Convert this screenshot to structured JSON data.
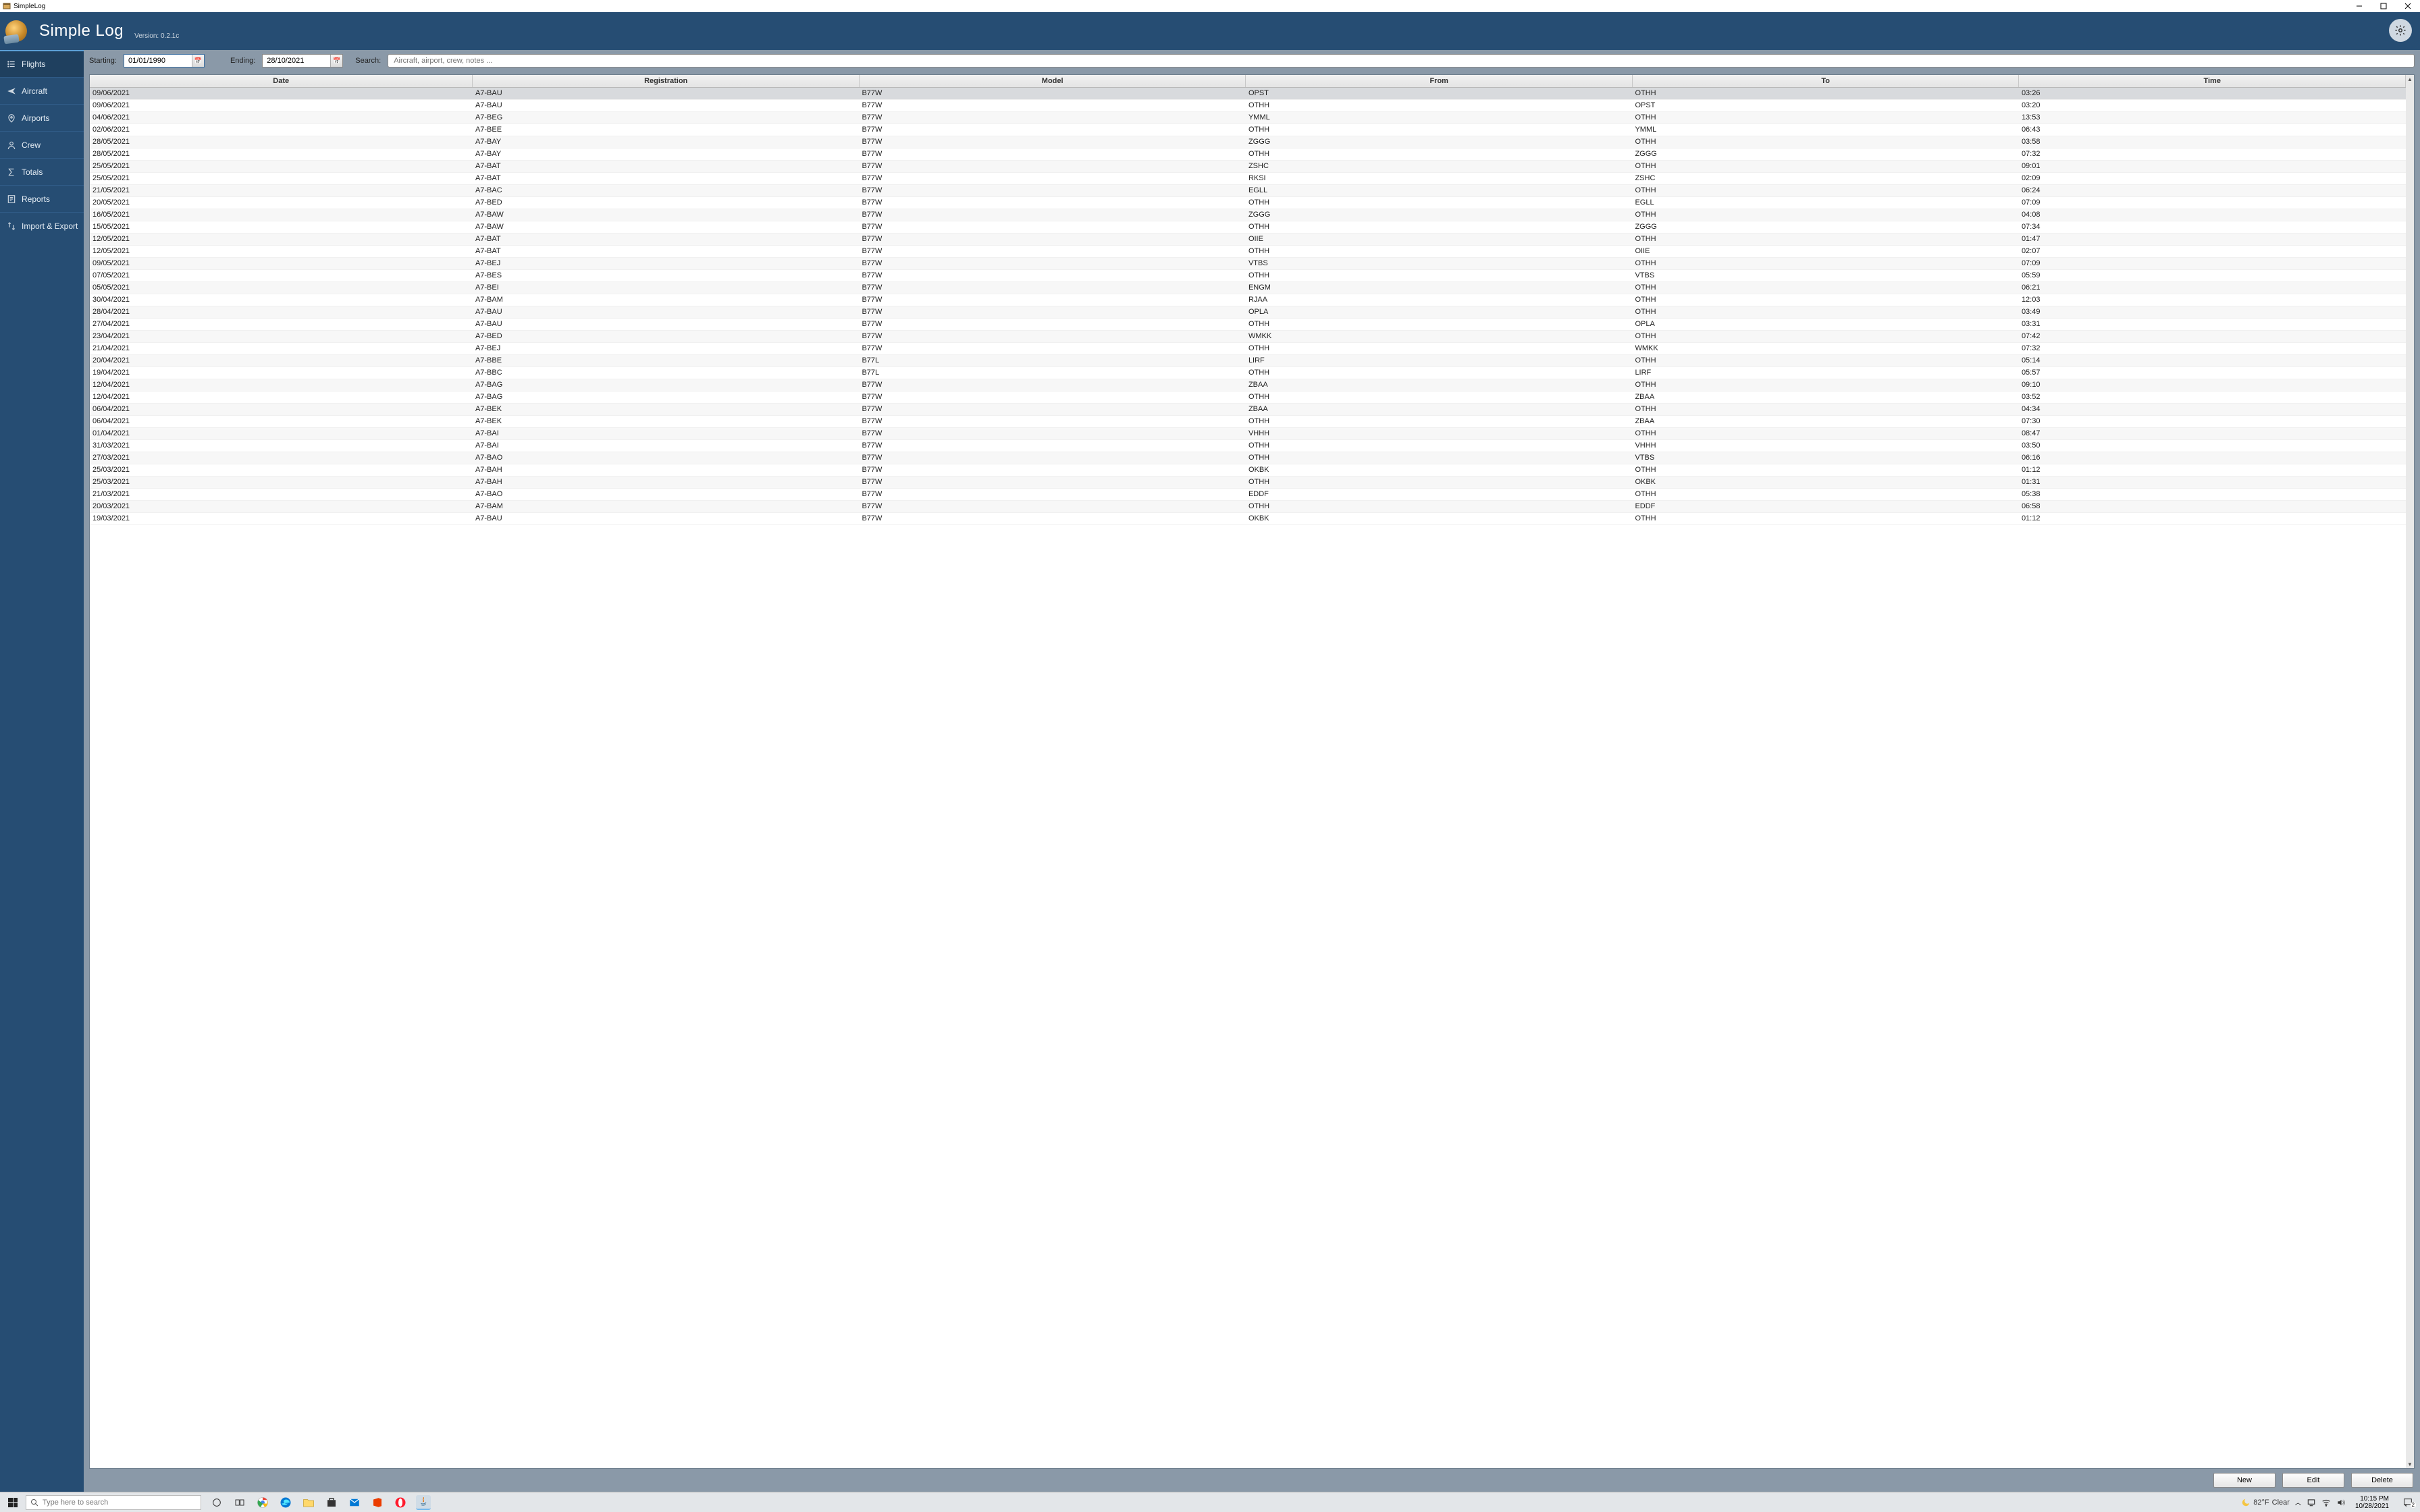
{
  "window": {
    "title": "SimpleLog"
  },
  "header": {
    "title": "Simple Log",
    "version": "Version: 0.2.1c"
  },
  "sidebar": {
    "items": [
      {
        "label": "Flights",
        "icon": "list-icon",
        "active": true
      },
      {
        "label": "Aircraft",
        "icon": "plane-icon",
        "active": false
      },
      {
        "label": "Airports",
        "icon": "pin-icon",
        "active": false
      },
      {
        "label": "Crew",
        "icon": "person-icon",
        "active": false
      },
      {
        "label": "Totals",
        "icon": "sigma-icon",
        "active": false
      },
      {
        "label": "Reports",
        "icon": "report-icon",
        "active": false
      },
      {
        "label": "Import & Export",
        "icon": "transfer-icon",
        "active": false
      }
    ]
  },
  "filters": {
    "starting_label": "Starting:",
    "ending_label": "Ending:",
    "search_label": "Search:",
    "starting_value": "01/01/1990",
    "ending_value": "28/10/2021",
    "search_placeholder": "Aircraft, airport, crew, notes ..."
  },
  "columns": [
    "Date",
    "Registration",
    "Model",
    "From",
    "To",
    "Time"
  ],
  "rows": [
    {
      "date": "09/06/2021",
      "reg": "A7-BAU",
      "model": "B77W",
      "from": "OPST",
      "to": "OTHH",
      "time": "03:26",
      "selected": true
    },
    {
      "date": "09/06/2021",
      "reg": "A7-BAU",
      "model": "B77W",
      "from": "OTHH",
      "to": "OPST",
      "time": "03:20"
    },
    {
      "date": "04/06/2021",
      "reg": "A7-BEG",
      "model": "B77W",
      "from": "YMML",
      "to": "OTHH",
      "time": "13:53"
    },
    {
      "date": "02/06/2021",
      "reg": "A7-BEE",
      "model": "B77W",
      "from": "OTHH",
      "to": "YMML",
      "time": "06:43"
    },
    {
      "date": "28/05/2021",
      "reg": "A7-BAY",
      "model": "B77W",
      "from": "ZGGG",
      "to": "OTHH",
      "time": "03:58"
    },
    {
      "date": "28/05/2021",
      "reg": "A7-BAY",
      "model": "B77W",
      "from": "OTHH",
      "to": "ZGGG",
      "time": "07:32"
    },
    {
      "date": "25/05/2021",
      "reg": "A7-BAT",
      "model": "B77W",
      "from": "ZSHC",
      "to": "OTHH",
      "time": "09:01"
    },
    {
      "date": "25/05/2021",
      "reg": "A7-BAT",
      "model": "B77W",
      "from": "RKSI",
      "to": "ZSHC",
      "time": "02:09"
    },
    {
      "date": "21/05/2021",
      "reg": "A7-BAC",
      "model": "B77W",
      "from": "EGLL",
      "to": "OTHH",
      "time": "06:24"
    },
    {
      "date": "20/05/2021",
      "reg": "A7-BED",
      "model": "B77W",
      "from": "OTHH",
      "to": "EGLL",
      "time": "07:09"
    },
    {
      "date": "16/05/2021",
      "reg": "A7-BAW",
      "model": "B77W",
      "from": "ZGGG",
      "to": "OTHH",
      "time": "04:08"
    },
    {
      "date": "15/05/2021",
      "reg": "A7-BAW",
      "model": "B77W",
      "from": "OTHH",
      "to": "ZGGG",
      "time": "07:34"
    },
    {
      "date": "12/05/2021",
      "reg": "A7-BAT",
      "model": "B77W",
      "from": "OIIE",
      "to": "OTHH",
      "time": "01:47"
    },
    {
      "date": "12/05/2021",
      "reg": "A7-BAT",
      "model": "B77W",
      "from": "OTHH",
      "to": "OIIE",
      "time": "02:07"
    },
    {
      "date": "09/05/2021",
      "reg": "A7-BEJ",
      "model": "B77W",
      "from": "VTBS",
      "to": "OTHH",
      "time": "07:09"
    },
    {
      "date": "07/05/2021",
      "reg": "A7-BES",
      "model": "B77W",
      "from": "OTHH",
      "to": "VTBS",
      "time": "05:59"
    },
    {
      "date": "05/05/2021",
      "reg": "A7-BEI",
      "model": "B77W",
      "from": "ENGM",
      "to": "OTHH",
      "time": "06:21"
    },
    {
      "date": "30/04/2021",
      "reg": "A7-BAM",
      "model": "B77W",
      "from": "RJAA",
      "to": "OTHH",
      "time": "12:03"
    },
    {
      "date": "28/04/2021",
      "reg": "A7-BAU",
      "model": "B77W",
      "from": "OPLA",
      "to": "OTHH",
      "time": "03:49"
    },
    {
      "date": "27/04/2021",
      "reg": "A7-BAU",
      "model": "B77W",
      "from": "OTHH",
      "to": "OPLA",
      "time": "03:31"
    },
    {
      "date": "23/04/2021",
      "reg": "A7-BED",
      "model": "B77W",
      "from": "WMKK",
      "to": "OTHH",
      "time": "07:42"
    },
    {
      "date": "21/04/2021",
      "reg": "A7-BEJ",
      "model": "B77W",
      "from": "OTHH",
      "to": "WMKK",
      "time": "07:32"
    },
    {
      "date": "20/04/2021",
      "reg": "A7-BBE",
      "model": "B77L",
      "from": "LIRF",
      "to": "OTHH",
      "time": "05:14"
    },
    {
      "date": "19/04/2021",
      "reg": "A7-BBC",
      "model": "B77L",
      "from": "OTHH",
      "to": "LIRF",
      "time": "05:57"
    },
    {
      "date": "12/04/2021",
      "reg": "A7-BAG",
      "model": "B77W",
      "from": "ZBAA",
      "to": "OTHH",
      "time": "09:10"
    },
    {
      "date": "12/04/2021",
      "reg": "A7-BAG",
      "model": "B77W",
      "from": "OTHH",
      "to": "ZBAA",
      "time": "03:52"
    },
    {
      "date": "06/04/2021",
      "reg": "A7-BEK",
      "model": "B77W",
      "from": "ZBAA",
      "to": "OTHH",
      "time": "04:34"
    },
    {
      "date": "06/04/2021",
      "reg": "A7-BEK",
      "model": "B77W",
      "from": "OTHH",
      "to": "ZBAA",
      "time": "07:30"
    },
    {
      "date": "01/04/2021",
      "reg": "A7-BAI",
      "model": "B77W",
      "from": "VHHH",
      "to": "OTHH",
      "time": "08:47"
    },
    {
      "date": "31/03/2021",
      "reg": "A7-BAI",
      "model": "B77W",
      "from": "OTHH",
      "to": "VHHH",
      "time": "03:50"
    },
    {
      "date": "27/03/2021",
      "reg": "A7-BAO",
      "model": "B77W",
      "from": "OTHH",
      "to": "VTBS",
      "time": "06:16"
    },
    {
      "date": "25/03/2021",
      "reg": "A7-BAH",
      "model": "B77W",
      "from": "OKBK",
      "to": "OTHH",
      "time": "01:12"
    },
    {
      "date": "25/03/2021",
      "reg": "A7-BAH",
      "model": "B77W",
      "from": "OTHH",
      "to": "OKBK",
      "time": "01:31"
    },
    {
      "date": "21/03/2021",
      "reg": "A7-BAO",
      "model": "B77W",
      "from": "EDDF",
      "to": "OTHH",
      "time": "05:38"
    },
    {
      "date": "20/03/2021",
      "reg": "A7-BAM",
      "model": "B77W",
      "from": "OTHH",
      "to": "EDDF",
      "time": "06:58"
    },
    {
      "date": "19/03/2021",
      "reg": "A7-BAU",
      "model": "B77W",
      "from": "OKBK",
      "to": "OTHH",
      "time": "01:12"
    }
  ],
  "actions": {
    "new": "New",
    "edit": "Edit",
    "del": "Delete"
  },
  "taskbar": {
    "search_placeholder": "Type here to search",
    "weather_temp": "82°F",
    "weather_cond": "Clear",
    "clock_time": "10:15 PM",
    "clock_date": "10/28/2021",
    "notif_count": "2"
  }
}
